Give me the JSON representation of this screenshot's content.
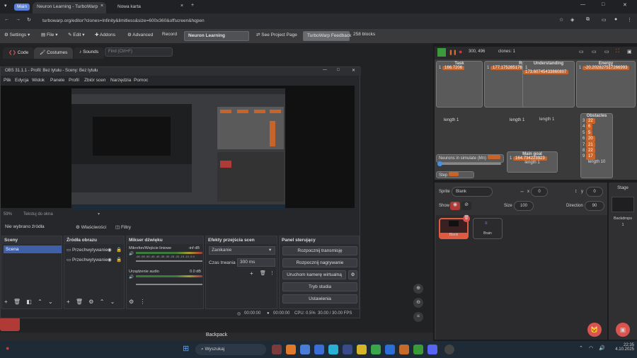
{
  "browser": {
    "tabs": [
      {
        "label": "Main"
      },
      {
        "label": "Neuron Learning - TurboWarp"
      },
      {
        "label": "Nowa karta"
      }
    ],
    "url": "turbowarp.org/editor?clones=Infinity&limitless&size=600x360&offscreen&hqpen"
  },
  "tw": {
    "settings": "Settings",
    "file": "File",
    "edit": "Edit",
    "addons": "Addons",
    "advanced": "Advanced",
    "record": "Record",
    "project_title": "Neuron Learning",
    "see_project": "See Project Page",
    "feedback": "TurboWarp Feedback",
    "blocks": "258 blocks",
    "tab_code": "Code",
    "tab_costumes": "Costumes",
    "tab_sounds": "Sounds",
    "find_placeholder": "Find (Ctrl+F)",
    "backpack": "Backpack",
    "stage_info": "300, 496",
    "clones": "clones: 1"
  },
  "obs": {
    "title": "OBS 31.1.1 - Profil: Bez tytułu - Sceny: Bez tytułu",
    "menu": [
      "Plik",
      "Edycja",
      "Widok",
      "Panele",
      "Profil",
      "Zbiór scen",
      "Narzędzia",
      "Pomoc"
    ],
    "status_pct": "59%",
    "status_text": "Tekstuj do okna",
    "no_source": "Nie wybrano źródła",
    "properties": "Właściwości",
    "filters": "Filtry",
    "scenes_title": "Sceny",
    "scene_item": "Scena",
    "sources_title": "Źródła obrazu",
    "sources": [
      "Przechwytywanie",
      "Przechwytywanie"
    ],
    "mixer_title": "Mikser dźwięku",
    "mixer": [
      {
        "name": "Mikrofon/Wejście liniowe",
        "db": "-inf dB"
      },
      {
        "name": "Urządzenie audio",
        "db": "0.0 dB"
      }
    ],
    "meter_ticks": [
      "-60",
      "-55",
      "-50",
      "-45",
      "-40",
      "-35",
      "-30",
      "-25",
      "-20",
      "-15",
      "-10",
      "-5",
      "0"
    ],
    "transitions_title": "Efekty przejścia scen",
    "transition": "Zanikanie",
    "duration_label": "Czas trwania",
    "duration": "300 ms",
    "controls_title": "Panel sterujący",
    "btn_stream": "Rozpocznij transmisję",
    "btn_record": "Rozpocznij nagrywanie",
    "btn_vcam": "Uruchom kamerę wirtualną",
    "btn_studio": "Tryb studia",
    "btn_settings": "Ustawienia",
    "stat_time1": "00:00:00",
    "stat_time2": "00:00:00",
    "cpu": "CPU: 0.5%",
    "fps": "30.00 / 30.00 FPS"
  },
  "stage": {
    "task_label": "Task",
    "task_value": "166.7206",
    "reward_label": "Reward",
    "reward_value": "177.17528517626032",
    "under_label": "Understanding",
    "under_value": "173.60745433860807",
    "energy_label": "Energy",
    "energy_value": "-20.202827517266993",
    "list_items": [
      "1"
    ],
    "length1": "length 1",
    "obstacles_label": "Obstacles",
    "obstacles_index": [
      "3",
      "4",
      "5",
      "6",
      "7",
      "8",
      "9",
      "10"
    ],
    "obstacles": [
      "22",
      "6",
      "5",
      "20",
      "21",
      "22",
      "17"
    ],
    "length10": "length 10",
    "neurons_label": "Neurons in simulate (Mn)",
    "step_label": "Step",
    "main_goal_label": "Main goal",
    "main_goal_value": "164.734223923",
    "length_mg": "length 1"
  },
  "sprite": {
    "sprite_label": "Sprite",
    "sprite_name": "Blank",
    "x_label": "x",
    "x_value": "0",
    "y_label": "y",
    "y_value": "0",
    "show_label": "Show",
    "size_label": "Size",
    "size_value": "100",
    "direction_label": "Direction",
    "direction_value": "90",
    "sprite1": "Blank",
    "sprite2": "Brain",
    "stage_label": "Stage",
    "backdrops_label": "Backdrops",
    "backdrops_count": "1"
  },
  "taskbar": {
    "search": "Wyszukaj",
    "time": "22:35",
    "date": "4.10.2025"
  }
}
